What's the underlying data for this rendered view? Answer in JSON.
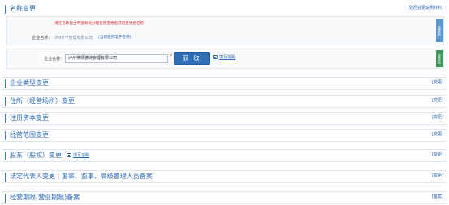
{
  "sections": {
    "name_change": {
      "title": "名称变更",
      "link": "[驳回变更说明材料]",
      "current": {
        "warning": "请在名称自主申报系统办理名称变更后获取变更后名称",
        "label": "企业名称:",
        "value": "泸州***管理有限公司",
        "note": "(当前使用电子名称)",
        "side_tab": "变更前"
      },
      "new": {
        "label": "企业名称:",
        "value": "泸州英晴德诗管理有限公司",
        "required_mark": "*",
        "fetch_button": "获 取",
        "help": "填写说明",
        "side_tab": "变更后"
      }
    },
    "company_type": {
      "title": "企业类型变更",
      "link": "[变更]"
    },
    "address": {
      "title": "住所（经营场所）变更",
      "link": "[变更]"
    },
    "capital": {
      "title": "注册资本变更",
      "link": "[变更]"
    },
    "scope": {
      "title": "经营范围变更",
      "link": "[变更]"
    },
    "shareholder": {
      "title": "股东（股权）变更",
      "help": "填写说明",
      "link": "[变更]"
    },
    "legal_rep": {
      "title": "法定代表人变更 | 董事、监事、高级管理人员备案",
      "link": "[变更]"
    },
    "term": {
      "title": "经营期限(营业期限)备案",
      "link": "[备案]"
    }
  },
  "colors": {
    "accent": "#2c67b1",
    "button": "#2f6fb8",
    "warning": "#e02020",
    "tab_before": "#5a9bd6",
    "tab_after": "#3d9a5a"
  }
}
